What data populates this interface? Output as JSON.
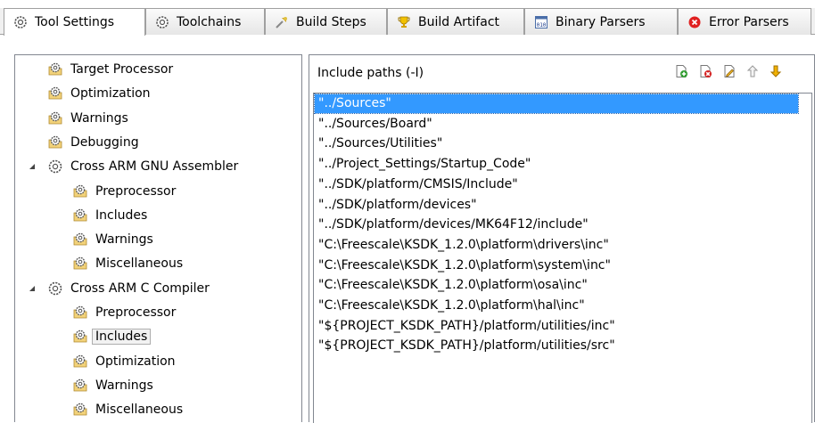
{
  "tabs": [
    {
      "label": "Tool Settings",
      "icon": "gear-icon",
      "active": true
    },
    {
      "label": "Toolchains",
      "icon": "gear-icon"
    },
    {
      "label": "Build Steps",
      "icon": "build-steps-icon"
    },
    {
      "label": "Build Artifact",
      "icon": "trophy-icon"
    },
    {
      "label": "Binary Parsers",
      "icon": "binary-icon"
    },
    {
      "label": "Error Parsers",
      "icon": "error-icon"
    }
  ],
  "tree": [
    {
      "label": "Target Processor"
    },
    {
      "label": "Optimization"
    },
    {
      "label": "Warnings"
    },
    {
      "label": "Debugging"
    },
    {
      "label": "Cross ARM GNU Assembler"
    },
    {
      "label": "Preprocessor"
    },
    {
      "label": "Includes"
    },
    {
      "label": "Warnings"
    },
    {
      "label": "Miscellaneous"
    },
    {
      "label": "Cross ARM C Compiler"
    },
    {
      "label": "Preprocessor"
    },
    {
      "label": "Includes",
      "selected": true
    },
    {
      "label": "Optimization"
    },
    {
      "label": "Warnings"
    },
    {
      "label": "Miscellaneous"
    }
  ],
  "include_paths": {
    "title": "Include paths (-I)",
    "toolbar": [
      "add-icon",
      "delete-icon",
      "edit-icon",
      "move-up-icon",
      "move-down-icon"
    ],
    "items": [
      "\"../Sources\"",
      "\"../Sources/Board\"",
      "\"../Sources/Utilities\"",
      "\"../Project_Settings/Startup_Code\"",
      "\"../SDK/platform/CMSIS/Include\"",
      "\"../SDK/platform/devices\"",
      "\"../SDK/platform/devices/MK64F12/include\"",
      "\"C:\\Freescale\\KSDK_1.2.0\\platform\\drivers\\inc\"",
      "\"C:\\Freescale\\KSDK_1.2.0\\platform\\system\\inc\"",
      "\"C:\\Freescale\\KSDK_1.2.0\\platform\\osa\\inc\"",
      "\"C:\\Freescale\\KSDK_1.2.0\\platform\\hal\\inc\"",
      "\"${PROJECT_KSDK_PATH}/platform/utilities/inc\"",
      "\"${PROJECT_KSDK_PATH}/platform/utilities/src\""
    ],
    "selected_index": 0
  },
  "colors": {
    "selection": "#3399ff",
    "border": "#828790",
    "tab_bg": "#f0f0f0"
  }
}
